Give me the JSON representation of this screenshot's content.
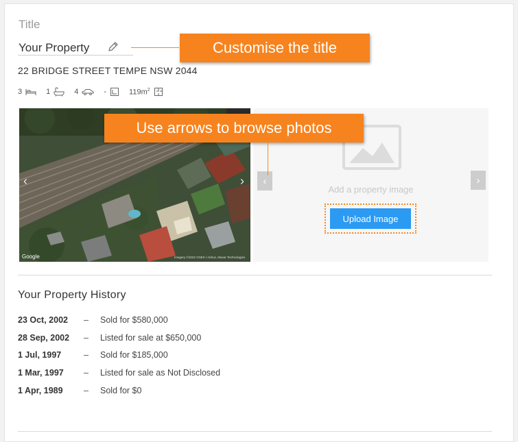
{
  "header": {
    "title_label": "Title",
    "title_value": "Your Property",
    "address": "22 BRIDGE STREET TEMPE NSW 2044"
  },
  "features": {
    "bedrooms": "3",
    "bathrooms": "1",
    "car_spaces": "4",
    "land": "-",
    "floor_area": "119m",
    "floor_area_unit_sup": "2"
  },
  "callouts": {
    "title_tip": "Customise the title",
    "arrows_tip": "Use arrows to browse photos"
  },
  "gallery": {
    "placeholder_text": "Add a property image",
    "upload_label": "Upload Image",
    "prev_label": "‹",
    "next_label": "›",
    "map_credit": "Google",
    "imagery_credit": "Imagery ©2022 CNES / Airbus, Maxar Technologies"
  },
  "history": {
    "title": "Your Property History",
    "rows": [
      {
        "date": "23 Oct, 2002",
        "event": "Sold for $580,000"
      },
      {
        "date": "28 Sep, 2002",
        "event": "Listed for sale at $650,000"
      },
      {
        "date": "1 Jul, 1997",
        "event": "Sold for $185,000"
      },
      {
        "date": "1 Mar, 1997",
        "event": "Listed for sale as Not Disclosed"
      },
      {
        "date": "1 Apr, 1989",
        "event": "Sold for $0"
      }
    ],
    "separator": "–"
  },
  "colors": {
    "callout": "#f7831e",
    "button": "#2b9af3"
  }
}
